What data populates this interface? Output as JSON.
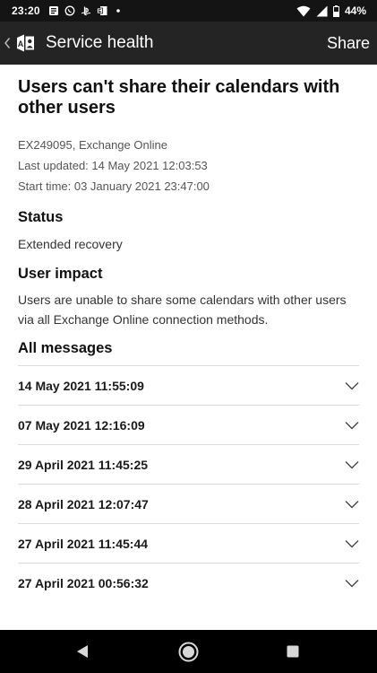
{
  "status_bar": {
    "time": "23:20",
    "battery": "44%",
    "icons": [
      "news-icon",
      "whatsapp-icon",
      "playstation-icon",
      "exchange-icon",
      "dot-icon",
      "wifi-icon",
      "signal-icon",
      "battery-icon"
    ]
  },
  "app_bar": {
    "title": "Service health",
    "share_label": "Share"
  },
  "incident": {
    "title": "Users can't share their calendars with other users",
    "id_line": "EX249095, Exchange Online",
    "last_updated": "Last updated: 14 May 2021 12:03:53",
    "start_time": "Start time: 03 January 2021 23:47:00"
  },
  "status": {
    "heading": "Status",
    "value": "Extended recovery"
  },
  "user_impact": {
    "heading": "User impact",
    "text": "Users are unable to share some calendars with other users via all Exchange Online connection methods."
  },
  "messages": {
    "heading": "All messages",
    "items": [
      {
        "date": "14 May 2021 11:55:09"
      },
      {
        "date": "07 May 2021 12:16:09"
      },
      {
        "date": "29 April 2021 11:45:25"
      },
      {
        "date": "28 April 2021 12:07:47"
      },
      {
        "date": "27 April 2021 11:45:44"
      },
      {
        "date": "27 April 2021 00:56:32"
      }
    ]
  },
  "colors": {
    "status_bar_bg": "#141414",
    "app_bar_bg": "#242424",
    "nav_bar_bg": "#000000",
    "divider": "#dcdcdc"
  }
}
